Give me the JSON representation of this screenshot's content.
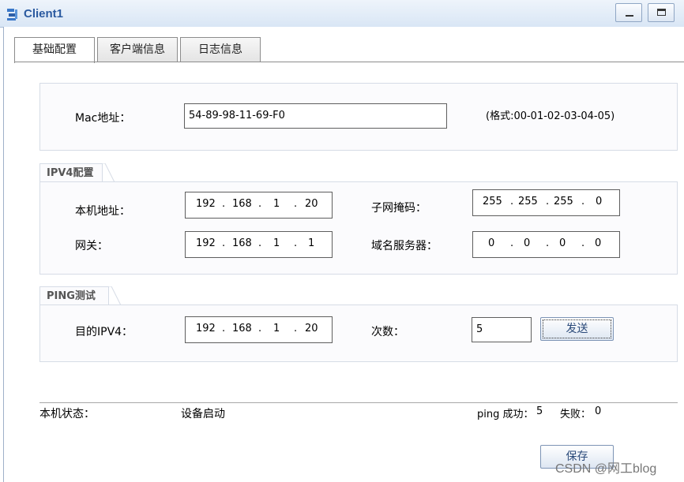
{
  "window": {
    "title": "Client1"
  },
  "tabs": [
    {
      "label": "基础配置",
      "active": true
    },
    {
      "label": "客户端信息",
      "active": false
    },
    {
      "label": "日志信息",
      "active": false
    }
  ],
  "mac": {
    "label": "Mac地址：",
    "value": "54-89-98-11-69-F0",
    "format_hint": "(格式:00-01-02-03-04-05)"
  },
  "ipv4": {
    "section_title": "IPV4配置",
    "host_address": {
      "label": "本机地址：",
      "octets": [
        "192",
        "168",
        "1",
        "20"
      ]
    },
    "subnet_mask": {
      "label": "子网掩码：",
      "octets": [
        "255",
        "255",
        "255",
        "0"
      ]
    },
    "gateway": {
      "label": "网关：",
      "octets": [
        "192",
        "168",
        "1",
        "1"
      ]
    },
    "dns_server": {
      "label": "域名服务器：",
      "octets": [
        "0",
        "0",
        "0",
        "0"
      ]
    }
  },
  "ping": {
    "section_title": "PING测试",
    "target": {
      "label": "目的IPV4：",
      "octets": [
        "192",
        "168",
        "1",
        "20"
      ]
    },
    "count": {
      "label": "次数：",
      "value": "5"
    },
    "send_label": "发送"
  },
  "status": {
    "label": "本机状态：",
    "value": "设备启动",
    "ping_success_label": "ping 成功：",
    "ping_success": "5",
    "ping_fail_label": "失败：",
    "ping_fail": "0"
  },
  "save_label": "保存",
  "watermark": "CSDN @网工blog"
}
